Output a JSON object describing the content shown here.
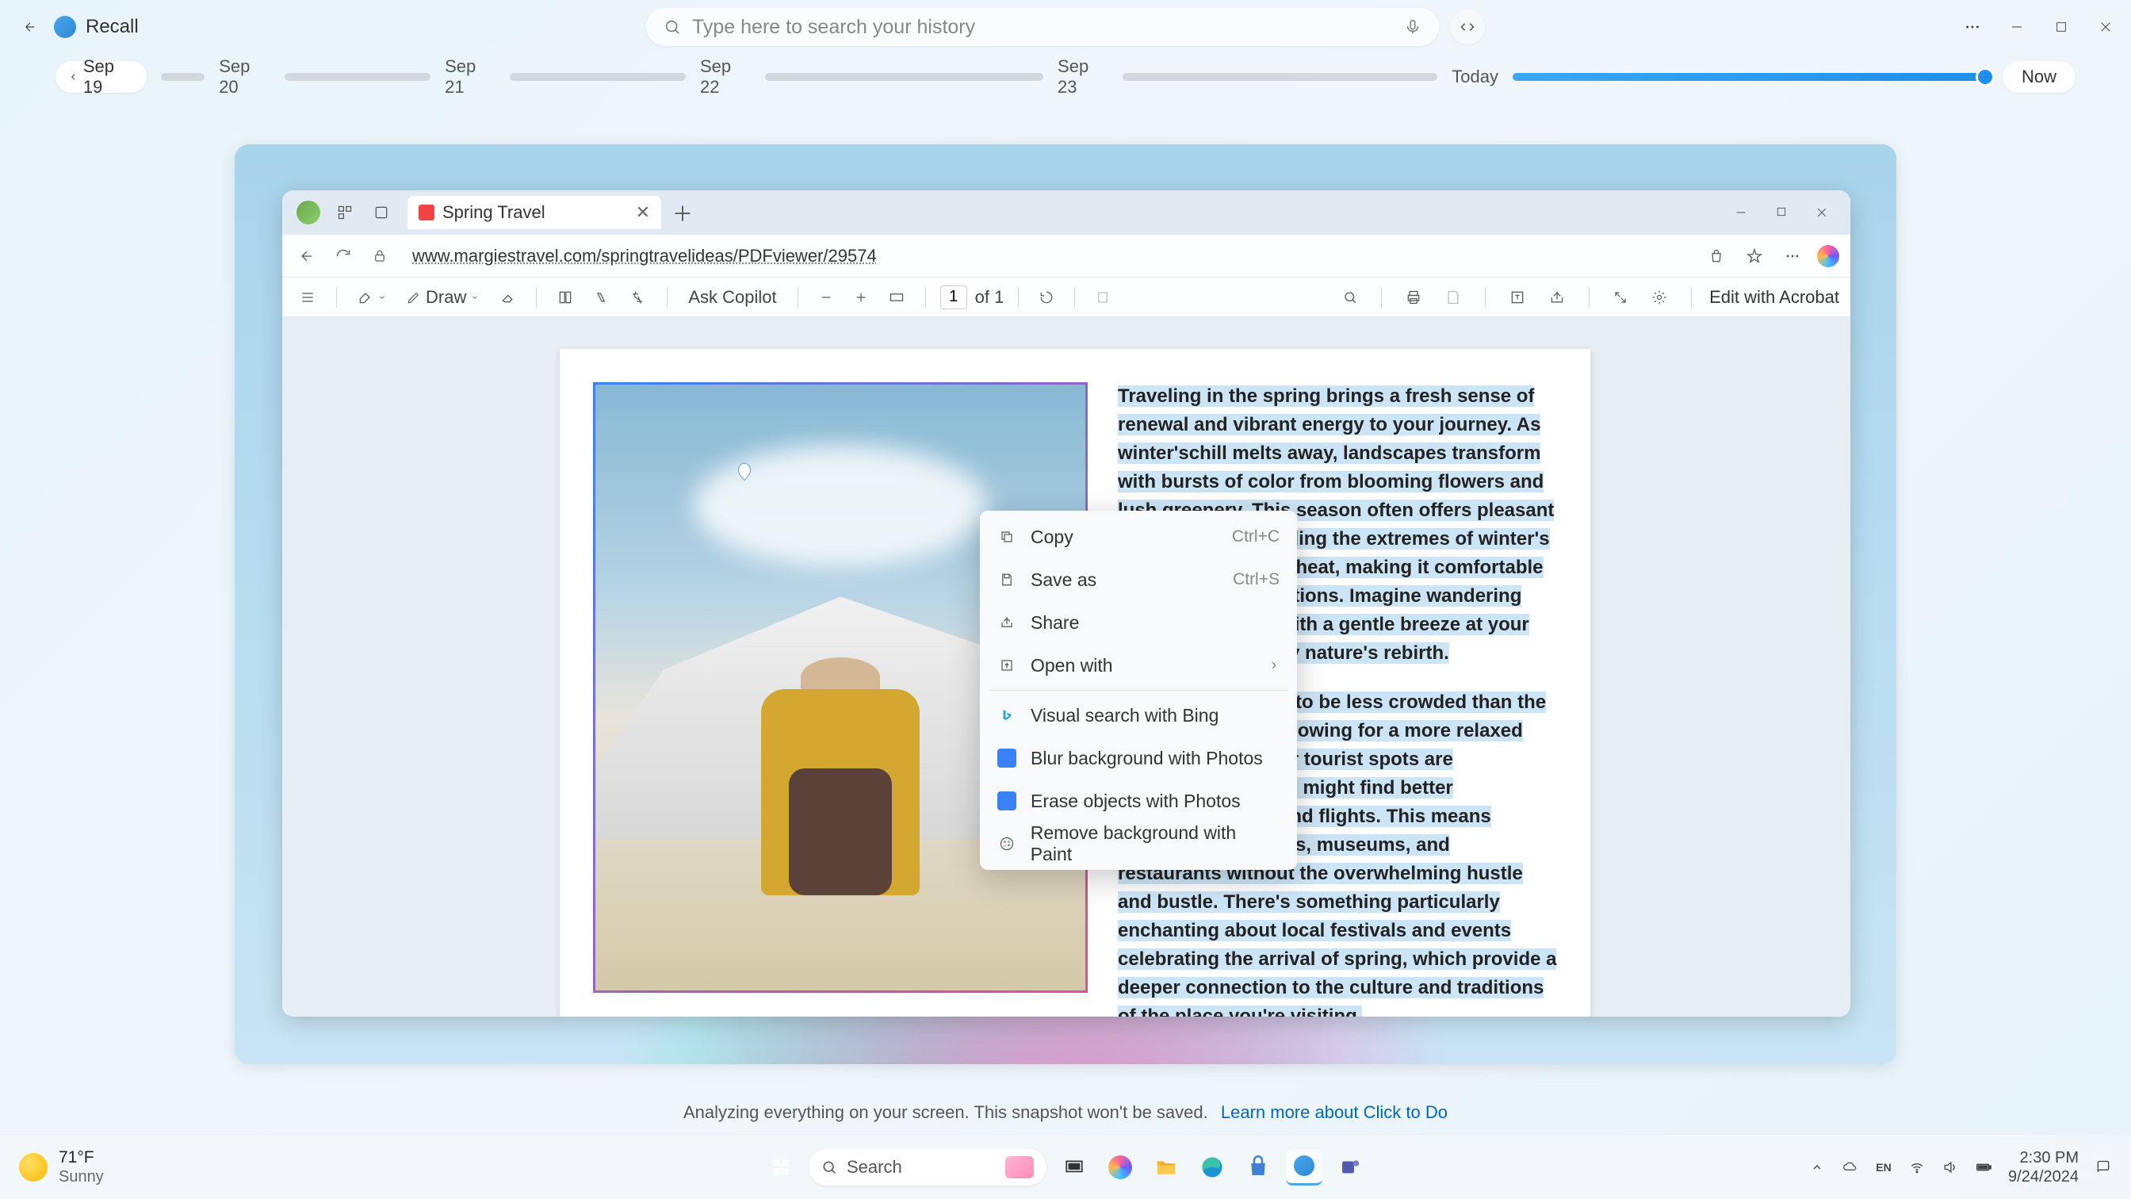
{
  "header": {
    "app_name": "Recall",
    "search_placeholder": "Type here to search your history"
  },
  "timeline": {
    "start": "Sep 19",
    "dates": [
      "Sep 20",
      "Sep 21",
      "Sep 22",
      "Sep 23"
    ],
    "today": "Today",
    "now": "Now"
  },
  "browser": {
    "tab_title": "Spring Travel",
    "url": "www.margiestravel.com/springtravelideas/PDFviewer/29574",
    "pdf_toolbar": {
      "draw": "Draw",
      "ask_copilot": "Ask Copilot",
      "page_current": "1",
      "page_total": "of 1",
      "edit_acrobat": "Edit with Acrobat"
    },
    "doc": {
      "p1": "Traveling in the spring brings a fresh sense of renewal and vibrant energy to your journey. As winter'schill melts away, landscapes transform with bursts of color from blooming flowers and lush greenery. This season often offers pleasant temperatures, avoiding the extremes of winter's cold and summer's heat, making it comfortable for outdoor explorations. Imagine wandering through gardens, with a gentle breeze at your back surrounded by nature's rebirth.",
      "p2": "Spring travel tends to be less crowded than the summer months, allowing for a more relaxed experience. Popular tourist spots are accessible, and you might find better accommodations and flights. This means exploring attractions, museums, and restaurants without the overwhelming hustle and bustle. There's something particularly enchanting about local festivals and events celebrating the arrival of spring, which provide a deeper connection to the culture and traditions of the place you're visiting."
    }
  },
  "context_menu": {
    "copy": {
      "label": "Copy",
      "shortcut": "Ctrl+C"
    },
    "save_as": {
      "label": "Save as",
      "shortcut": "Ctrl+S"
    },
    "share": "Share",
    "open_with": "Open with",
    "visual_search": "Visual search with Bing",
    "blur_bg": "Blur background with Photos",
    "erase_obj": "Erase objects with Photos",
    "remove_bg": "Remove background with Paint"
  },
  "notice": {
    "text": "Analyzing everything on your screen. This snapshot won't be saved.",
    "link": "Learn more about Click to Do"
  },
  "taskbar": {
    "weather_temp": "71°F",
    "weather_cond": "Sunny",
    "search": "Search",
    "time": "2:30 PM",
    "date": "9/24/2024"
  }
}
